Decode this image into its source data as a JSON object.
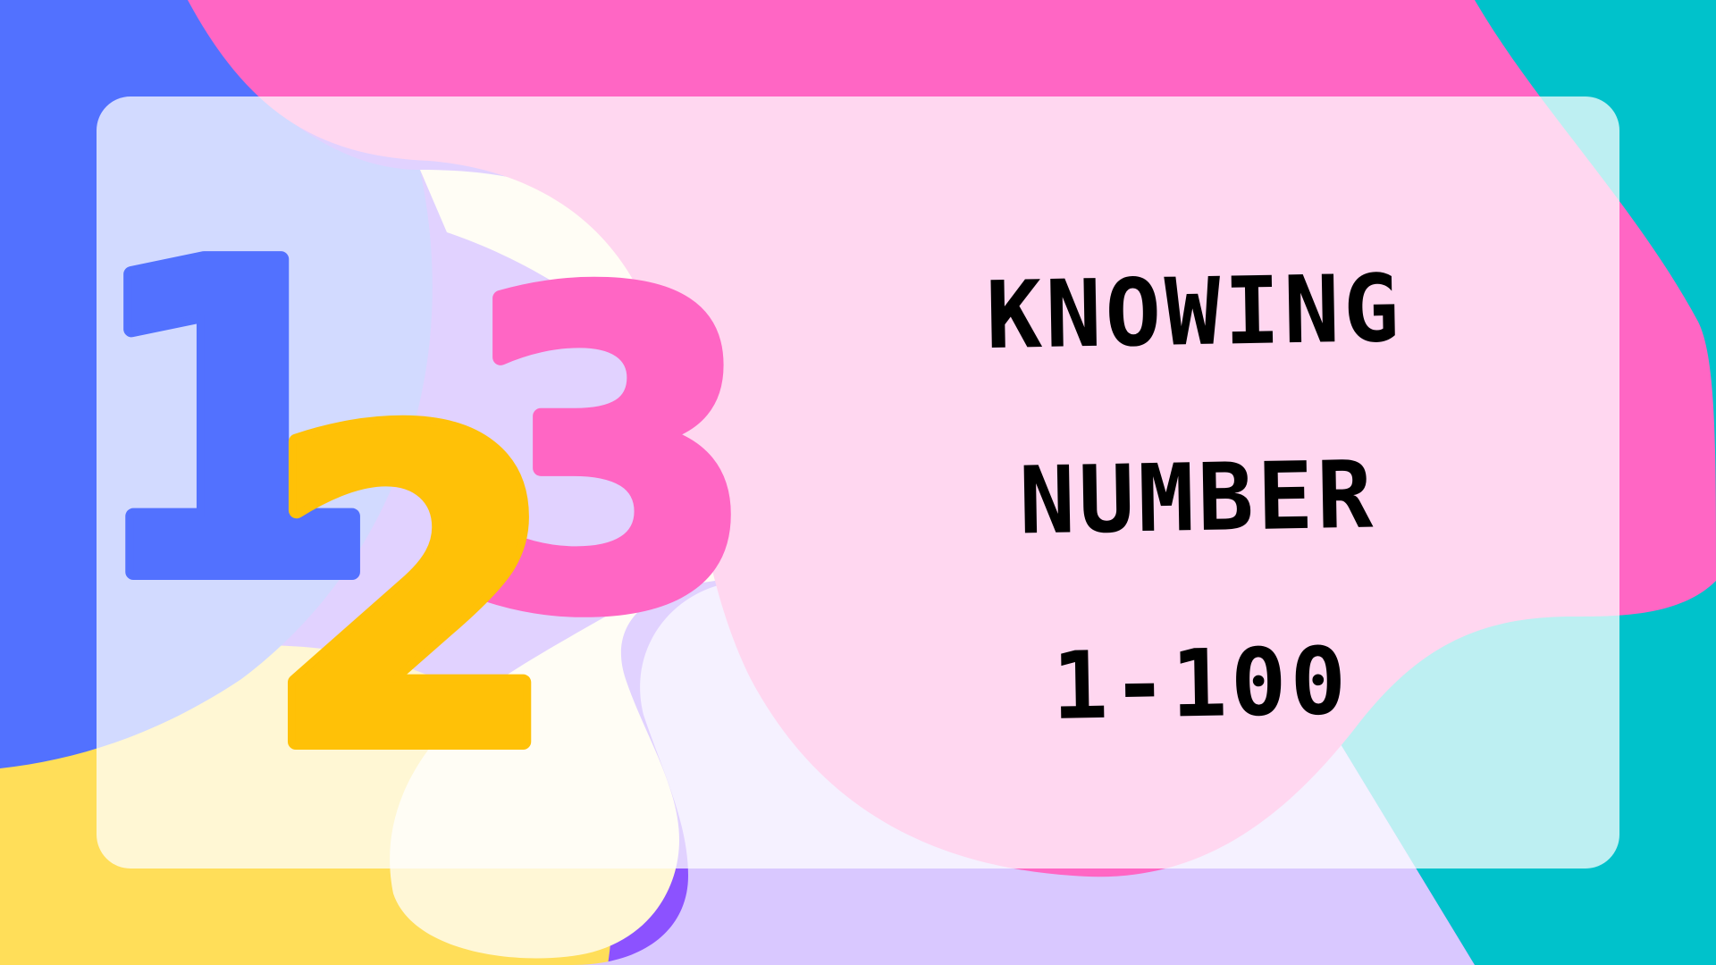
{
  "title": {
    "line1": "KNOWING",
    "line2": "NUMBER",
    "line3": "1-100"
  },
  "numerals": {
    "one": "1",
    "two": "2",
    "three": "3"
  },
  "colors": {
    "blue": "#5271ff",
    "pink": "#ff66c4",
    "yellow": "#ffc107",
    "light_yellow": "#ffde59",
    "teal": "#00c2cb",
    "purple": "#8c52ff",
    "panel": "#ffffff"
  }
}
